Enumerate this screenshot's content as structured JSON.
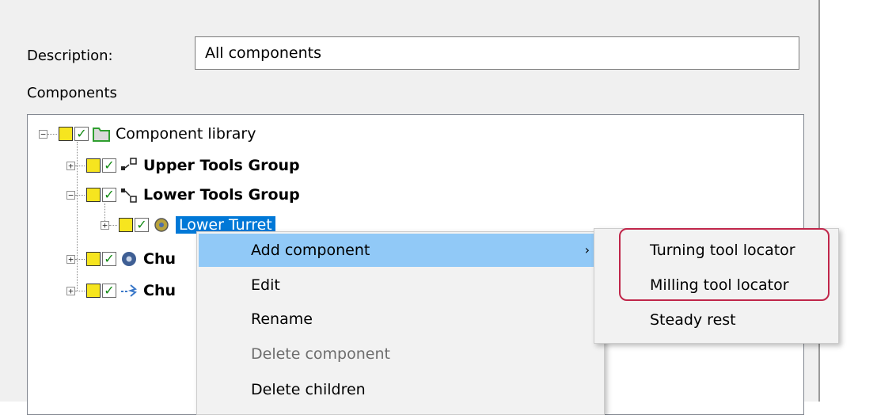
{
  "dialog": {
    "description_label": "Description:",
    "description_value": "All components",
    "components_label": "Components"
  },
  "tree": {
    "root": {
      "label": "Component library",
      "expander": "−"
    },
    "items": [
      {
        "label": "Upper Tools Group",
        "expander": "+"
      },
      {
        "label": "Lower Tools Group",
        "expander": "−"
      },
      {
        "label": "Lower Turret",
        "expander": "+",
        "selected": true
      },
      {
        "label": "Chu",
        "expander": "+"
      },
      {
        "label": "Chu",
        "expander": "+"
      }
    ]
  },
  "context_menu": {
    "items": [
      {
        "label": "Add component",
        "submenu_arrow": "›",
        "highlighted": true
      },
      {
        "label": "Edit"
      },
      {
        "label": "Rename"
      },
      {
        "label": "Delete component",
        "disabled": true
      },
      {
        "label": "Delete children"
      }
    ]
  },
  "submenu": {
    "items": [
      {
        "label": "Turning tool locator"
      },
      {
        "label": "Milling tool locator"
      },
      {
        "label": "Steady rest"
      }
    ]
  },
  "colors": {
    "selection": "#0078d7",
    "menu_highlight": "#91c9f7",
    "callout_outline": "#c0264a",
    "state_box": "#f6e51f",
    "checkmark": "#128a12"
  }
}
